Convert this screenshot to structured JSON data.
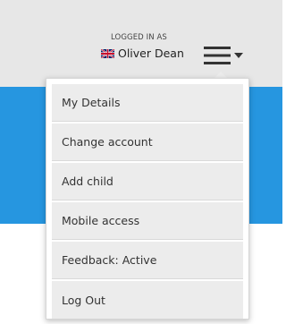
{
  "header": {
    "logged_in_label": "LOGGED IN AS",
    "user_name": "Oliver Dean",
    "flag_icon": "uk-flag-icon",
    "menu_icon": "hamburger-menu-icon",
    "menu_caret_icon": "caret-down-icon"
  },
  "colors": {
    "header_bg": "#e7e7e7",
    "accent_blue": "#2696e0",
    "menu_item_bg": "#ececec"
  },
  "menu": {
    "items": [
      {
        "label": "My Details"
      },
      {
        "label": "Change account"
      },
      {
        "label": "Add child"
      },
      {
        "label": "Mobile access"
      },
      {
        "label": "Feedback: Active"
      },
      {
        "label": "Log Out"
      }
    ]
  }
}
